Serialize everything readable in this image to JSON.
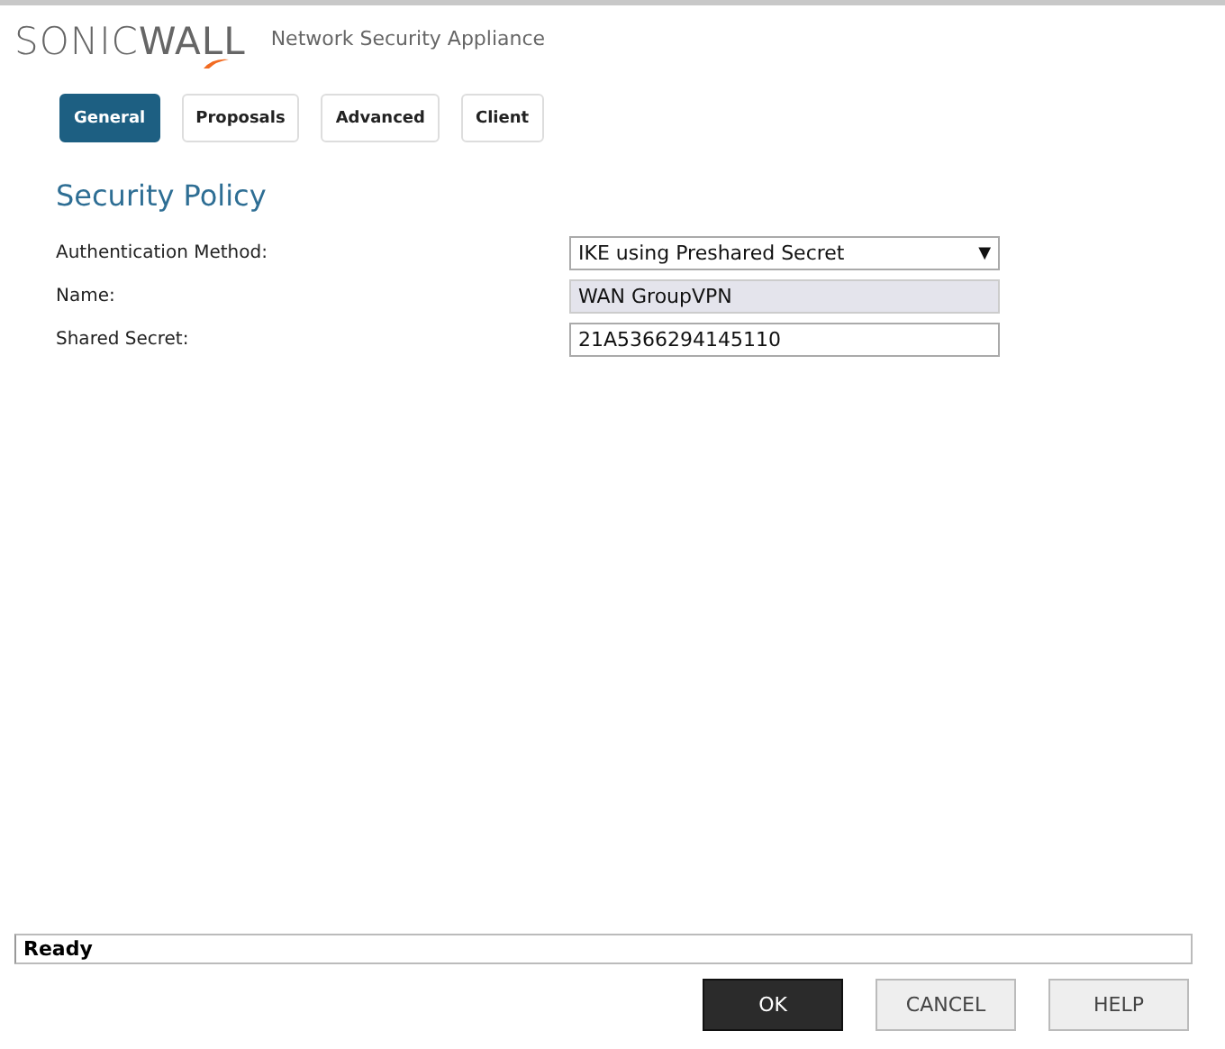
{
  "header": {
    "logo": "SONIC**WALL**",
    "subtitle": "Network Security Appliance"
  },
  "tabs": [
    {
      "label": "General",
      "selected": true
    },
    {
      "label": "Proposals",
      "selected": false
    },
    {
      "label": "Advanced",
      "selected": false
    },
    {
      "label": "Client",
      "selected": false
    }
  ],
  "section_title": "Security Policy",
  "fields": [
    {
      "label": "Authentication Method:",
      "kind": "select",
      "value": "IKE using Preshared Secret",
      "arrow": "▼"
    },
    {
      "label": "Name:",
      "kind": "readonly",
      "value": "WAN GroupVPN"
    },
    {
      "label": "Shared Secret:",
      "kind": "text",
      "value": "21A5366294145110"
    }
  ],
  "status_bar": "Ready",
  "buttons": [
    {
      "label": "OK",
      "primary": true
    },
    {
      "label": "CANCEL",
      "primary": false
    },
    {
      "label": "HELP",
      "primary": false
    }
  ]
}
